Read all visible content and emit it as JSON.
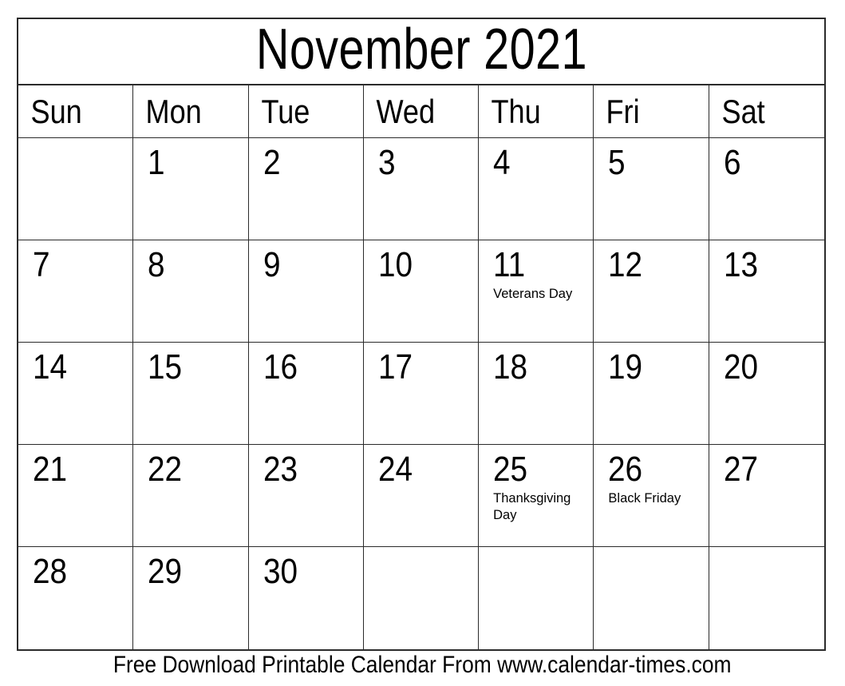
{
  "document": {
    "type": "printable-monthly-calendar",
    "title": "November 2021",
    "month": "November",
    "year": "2021"
  },
  "colors": {
    "background": "#ffffff",
    "text": "#000000",
    "grid_line": "#2b2b2b"
  },
  "weekdays": [
    {
      "label": "Sun"
    },
    {
      "label": "Mon"
    },
    {
      "label": "Tue"
    },
    {
      "label": "Wed"
    },
    {
      "label": "Thu"
    },
    {
      "label": "Fri"
    },
    {
      "label": "Sat"
    }
  ],
  "weeks": [
    [
      {
        "day": "",
        "event": ""
      },
      {
        "day": "1",
        "event": ""
      },
      {
        "day": "2",
        "event": ""
      },
      {
        "day": "3",
        "event": ""
      },
      {
        "day": "4",
        "event": ""
      },
      {
        "day": "5",
        "event": ""
      },
      {
        "day": "6",
        "event": ""
      }
    ],
    [
      {
        "day": "7",
        "event": ""
      },
      {
        "day": "8",
        "event": ""
      },
      {
        "day": "9",
        "event": ""
      },
      {
        "day": "10",
        "event": ""
      },
      {
        "day": "11",
        "event": "Veterans Day"
      },
      {
        "day": "12",
        "event": ""
      },
      {
        "day": "13",
        "event": ""
      }
    ],
    [
      {
        "day": "14",
        "event": ""
      },
      {
        "day": "15",
        "event": ""
      },
      {
        "day": "16",
        "event": ""
      },
      {
        "day": "17",
        "event": ""
      },
      {
        "day": "18",
        "event": ""
      },
      {
        "day": "19",
        "event": ""
      },
      {
        "day": "20",
        "event": ""
      }
    ],
    [
      {
        "day": "21",
        "event": ""
      },
      {
        "day": "22",
        "event": ""
      },
      {
        "day": "23",
        "event": ""
      },
      {
        "day": "24",
        "event": ""
      },
      {
        "day": "25",
        "event": "Thanksgiving Day"
      },
      {
        "day": "26",
        "event": "Black Friday"
      },
      {
        "day": "27",
        "event": ""
      }
    ],
    [
      {
        "day": "28",
        "event": ""
      },
      {
        "day": "29",
        "event": ""
      },
      {
        "day": "30",
        "event": ""
      },
      {
        "day": "",
        "event": ""
      },
      {
        "day": "",
        "event": ""
      },
      {
        "day": "",
        "event": ""
      },
      {
        "day": "",
        "event": ""
      }
    ]
  ],
  "footer": {
    "text": "Free Download Printable Calendar From www.calendar-times.com"
  }
}
